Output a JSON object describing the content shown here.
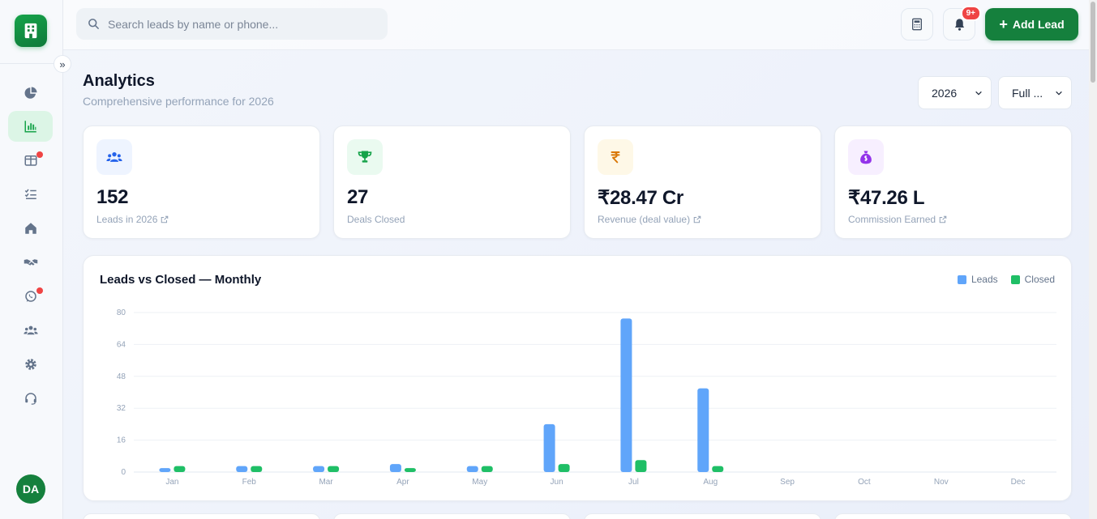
{
  "sidebar": {
    "avatar_initials": "DA",
    "items": [
      {
        "icon": "pie-chart-icon",
        "active": false
      },
      {
        "icon": "bar-chart-icon",
        "active": true
      },
      {
        "icon": "board-icon",
        "active": false,
        "dot": true
      },
      {
        "icon": "checklist-icon",
        "active": false
      },
      {
        "icon": "home-icon",
        "active": false
      },
      {
        "icon": "handshake-icon",
        "active": false
      },
      {
        "icon": "whatsapp-icon",
        "active": false,
        "dot": true
      },
      {
        "icon": "users-icon",
        "active": false
      },
      {
        "icon": "gear-icon",
        "active": false
      },
      {
        "icon": "headset-icon",
        "active": false
      }
    ]
  },
  "topbar": {
    "search_placeholder": "Search leads by name or phone...",
    "notification_badge": "9+",
    "add_lead_label": "Add Lead"
  },
  "header": {
    "title": "Analytics",
    "subtitle": "Comprehensive performance for 2026",
    "year_select": "2026",
    "period_select": "Full ..."
  },
  "kpis": [
    {
      "value": "152",
      "label": "Leads in 2026",
      "icon": "users-icon",
      "color": "#2563eb",
      "bg": "#eef4ff"
    },
    {
      "value": "27",
      "label": "Deals Closed",
      "icon": "trophy-icon",
      "color": "#16a34a",
      "bg": "#eafaf0"
    },
    {
      "value": "₹28.47 Cr",
      "label": "Revenue (deal value)",
      "icon": "rupee-icon",
      "color": "#d97706",
      "bg": "#fef8e7"
    },
    {
      "value": "₹47.26 L",
      "label": "Commission Earned",
      "icon": "money-bag-icon",
      "color": "#9333ea",
      "bg": "#f7efff"
    }
  ],
  "chart": {
    "title": "Leads vs Closed — Monthly",
    "legend_leads": "Leads",
    "legend_closed": "Closed"
  },
  "colors": {
    "leads": "#60a5fa",
    "closed": "#1fbf66",
    "brand": "#15803d"
  },
  "chart_data": {
    "type": "bar",
    "title": "Leads vs Closed — Monthly",
    "categories": [
      "Jan",
      "Feb",
      "Mar",
      "Apr",
      "May",
      "Jun",
      "Jul",
      "Aug",
      "Sep",
      "Oct",
      "Nov",
      "Dec"
    ],
    "series": [
      {
        "name": "Leads",
        "values": [
          2,
          3,
          3,
          4,
          3,
          24,
          77,
          42,
          0,
          0,
          0,
          0
        ]
      },
      {
        "name": "Closed",
        "values": [
          3,
          3,
          3,
          2,
          3,
          4,
          6,
          3,
          0,
          0,
          0,
          0
        ]
      }
    ],
    "yticks": [
      "80",
      "64",
      "48",
      "32",
      "16",
      "0"
    ],
    "ylim": [
      0,
      80
    ],
    "grid": true,
    "legend": "top-right"
  }
}
